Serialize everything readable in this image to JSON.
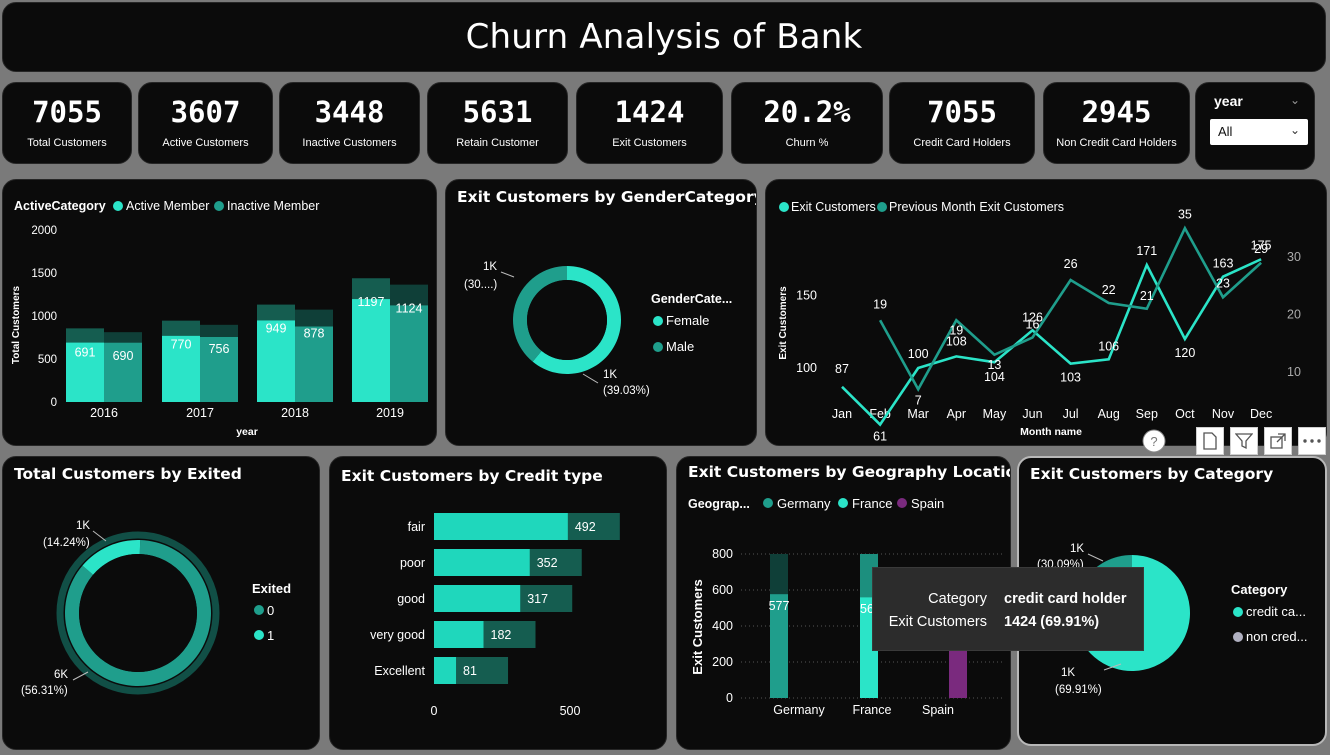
{
  "title": "Churn Analysis of Bank",
  "kpis": [
    {
      "value": "7055",
      "label": "Total Customers"
    },
    {
      "value": "3607",
      "label": "Active Customers"
    },
    {
      "value": "3448",
      "label": "Inactive Customers"
    },
    {
      "value": "5631",
      "label": "Retain Customer"
    },
    {
      "value": "1424",
      "label": "Exit Customers"
    },
    {
      "value": "20.2%",
      "label": "Churn %"
    },
    {
      "value": "7055",
      "label": "Credit Card Holders"
    },
    {
      "value": "2945",
      "label": "Non Credit Card Holders"
    }
  ],
  "slicer": {
    "label": "year",
    "value": "All",
    "chevron_icon": "chevron-down-icon"
  },
  "colors": {
    "teal_bright": "#2be4c8",
    "teal_mid": "#1f9e8c",
    "teal_dark": "#155d50",
    "purple": "#7a2a7e",
    "card_bg": "#0b0b0b"
  },
  "chart_data": [
    {
      "id": "active_members",
      "type": "bar",
      "legend_title": "ActiveCategory",
      "categories": [
        "2016",
        "2017",
        "2018",
        "2019"
      ],
      "series": [
        {
          "name": "Active Member",
          "values": [
            691,
            770,
            949,
            1197
          ],
          "color": "#2be4c8"
        },
        {
          "name": "Inactive Member",
          "values": [
            690,
            756,
            878,
            1124
          ],
          "color": "#1f9e8c"
        }
      ],
      "xlabel": "year",
      "ylabel": "Total Customers",
      "ylim": [
        0,
        2000
      ],
      "yticks": [
        "0",
        "500",
        "1000",
        "1500",
        "2000"
      ],
      "legend": "top-left"
    },
    {
      "id": "exit_gender",
      "type": "pie",
      "title": "Exit Customers by GenderCategory",
      "legend_title": "GenderCate...",
      "slices": [
        {
          "name": "Female",
          "value": 60.97,
          "color": "#2be4c8"
        },
        {
          "name": "Male",
          "value": 39.03,
          "color": "#1f9e8c"
        }
      ],
      "labels": [
        {
          "text": "1K",
          "sub": "(30....)"
        },
        {
          "text": "1K",
          "sub": "(39.03%)"
        }
      ],
      "legend": "right"
    },
    {
      "id": "exit_month",
      "type": "line",
      "categories": [
        "Jan",
        "Feb",
        "Mar",
        "Apr",
        "May",
        "Jun",
        "Jul",
        "Aug",
        "Sep",
        "Oct",
        "Nov",
        "Dec"
      ],
      "series": [
        {
          "name": "Exit Customers",
          "values": [
            87,
            61,
            100,
            108,
            104,
            126,
            103,
            106,
            171,
            120,
            163,
            175
          ],
          "color": "#2be4c8"
        },
        {
          "name": "Previous Month Exit Customers",
          "values": [
            null,
            19,
            7,
            19,
            13,
            16,
            26,
            22,
            21,
            35,
            23,
            29
          ],
          "color": "#1f9e8c"
        }
      ],
      "xlabel": "Month name",
      "ylabel": "Exit Customers",
      "yticks_left": [
        "100",
        "150"
      ],
      "yticks_right": [
        "10",
        "20",
        "30"
      ],
      "legend": "top-left"
    },
    {
      "id": "total_exited",
      "type": "pie",
      "title": "Total Customers by Exited",
      "legend_title": "Exited",
      "slices": [
        {
          "name": "0",
          "value": 85.76,
          "color": "#1f9e8c"
        },
        {
          "name": "1",
          "value": 14.24,
          "color": "#2be4c8"
        }
      ],
      "labels": [
        {
          "text": "1K",
          "sub": "(14.24%)"
        },
        {
          "text": "6K",
          "sub": "(56.31%)"
        }
      ],
      "legend": "right"
    },
    {
      "id": "credit_type",
      "type": "bar",
      "title": "Exit Customers by Credit type",
      "categories": [
        "fair",
        "poor",
        "good",
        "very good",
        "Excellent"
      ],
      "values": [
        492,
        352,
        317,
        182,
        81
      ],
      "xticks": [
        "0",
        "500"
      ],
      "orientation": "horizontal"
    },
    {
      "id": "geography",
      "type": "bar",
      "title": "Exit Customers by Geography Location",
      "legend_title": "Geograp...",
      "categories": [
        "Germany",
        "France",
        "Spain"
      ],
      "series": [
        {
          "name": "Germany",
          "values": [
            577,
            null,
            null
          ],
          "color": "#1f9e8c"
        },
        {
          "name": "France",
          "values": [
            null,
            560,
            null
          ],
          "color": "#2be4c8"
        },
        {
          "name": "Spain",
          "values": [
            null,
            null,
            287
          ],
          "color": "#7a2a7e"
        }
      ],
      "data_labels": [
        "577",
        "56",
        ""
      ],
      "ylabel": "Exit Customers",
      "ylim": [
        0,
        800
      ],
      "yticks": [
        "0",
        "200",
        "400",
        "600",
        "800"
      ],
      "legend": "top-left"
    },
    {
      "id": "category",
      "type": "pie",
      "title": "Exit Customers by Category",
      "legend_title": "Category",
      "slices": [
        {
          "name": "credit ca...",
          "value": 69.91,
          "color": "#2be4c8"
        },
        {
          "name": "non cred...",
          "value": 30.09,
          "color": "#1f9e8c"
        }
      ],
      "labels": [
        {
          "text": "1K",
          "sub": "(30.09%)"
        },
        {
          "text": "1K",
          "sub": "(69.91%)"
        }
      ],
      "legend": "right"
    }
  ],
  "tooltip": {
    "k1": "Category",
    "v1": "credit card holder",
    "k2": "Exit Customers",
    "v2": "1424 (69.91%)"
  },
  "toolbar": [
    "help-icon",
    "page-icon",
    "filter-icon",
    "focus-mode-icon",
    "more-options-icon"
  ]
}
